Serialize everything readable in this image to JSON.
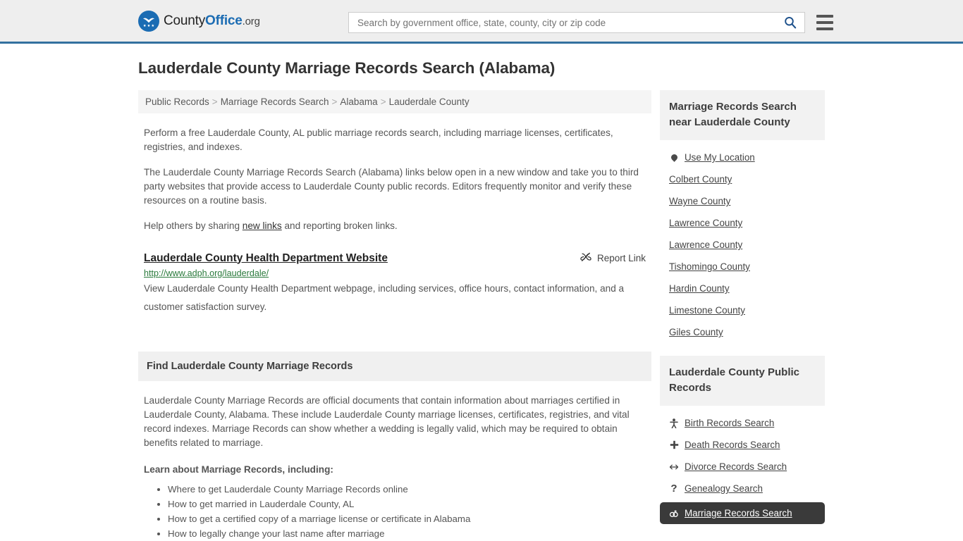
{
  "header": {
    "logo": {
      "icon": "eagle-seal-icon",
      "text_primary": "County",
      "text_bold": "Office",
      "text_suffix": ".org"
    },
    "search": {
      "placeholder": "Search by government office, state, county, city or zip code",
      "value": "",
      "search_icon": "search-icon"
    },
    "menu_icon": "hamburger-menu-icon"
  },
  "page": {
    "title": "Lauderdale County Marriage Records Search (Alabama)"
  },
  "breadcrumb": {
    "items": [
      {
        "label": "Public Records"
      },
      {
        "label": "Marriage Records Search"
      },
      {
        "label": "Alabama"
      },
      {
        "label": "Lauderdale County"
      }
    ],
    "separator": ">"
  },
  "intro": {
    "paragraph_1": "Perform a free Lauderdale County, AL public marriage records search, including marriage licenses, certificates, registries, and indexes.",
    "paragraph_2": "The Lauderdale County Marriage Records Search (Alabama) links below open in a new window and take you to third party websites that provide access to Lauderdale County public records. Editors frequently monitor and verify these resources on a routine basis.",
    "help_prefix": "Help others by sharing ",
    "help_link": "new links",
    "help_suffix": " and reporting broken links."
  },
  "result": {
    "title": "Lauderdale County Health Department Website",
    "report_label": "Report Link",
    "report_icon": "broken-link-icon",
    "url": "http://www.adph.org/lauderdale/",
    "description": "View Lauderdale County Health Department webpage, including services, office hours, contact information, and a customer satisfaction survey."
  },
  "find_section": {
    "heading": "Find Lauderdale County Marriage Records",
    "body": "Lauderdale County Marriage Records are official documents that contain information about marriages certified in Lauderdale County, Alabama. These include Lauderdale County marriage licenses, certificates, registries, and vital record indexes. Marriage Records can show whether a wedding is legally valid, which may be required to obtain benefits related to marriage.",
    "learn_label": "Learn about Marriage Records, including:",
    "learn_items": [
      "Where to get Lauderdale County Marriage Records online",
      "How to get married in Lauderdale County, AL",
      "How to get a certified copy of a marriage license or certificate in Alabama",
      "How to legally change your last name after marriage"
    ]
  },
  "sidebar": {
    "nearby": {
      "heading": "Marriage Records Search near Lauderdale County",
      "items": [
        {
          "label": "Use My Location",
          "icon": "map-pin-icon"
        },
        {
          "label": "Colbert County",
          "icon": ""
        },
        {
          "label": "Wayne County",
          "icon": ""
        },
        {
          "label": "Lawrence County",
          "icon": ""
        },
        {
          "label": "Lawrence County",
          "icon": ""
        },
        {
          "label": "Tishomingo County",
          "icon": ""
        },
        {
          "label": "Hardin County",
          "icon": ""
        },
        {
          "label": "Limestone County",
          "icon": ""
        },
        {
          "label": "Giles County",
          "icon": ""
        }
      ]
    },
    "public_records": {
      "heading": "Lauderdale County Public Records",
      "items": [
        {
          "label": "Birth Records Search",
          "icon": "baby-icon",
          "glyph": "Ɣ",
          "active": false
        },
        {
          "label": "Death Records Search",
          "icon": "cross-icon",
          "glyph": "✚",
          "active": false
        },
        {
          "label": "Divorce Records Search",
          "icon": "left-right-arrow-icon",
          "glyph": "↔",
          "active": false
        },
        {
          "label": "Genealogy Search",
          "icon": "question-mark-icon",
          "glyph": "?",
          "active": false
        },
        {
          "label": "Marriage Records Search",
          "icon": "rings-icon",
          "glyph": "⚭",
          "active": true
        }
      ]
    }
  },
  "colors": {
    "brand_blue": "#1b6cb3",
    "header_border": "#33709f",
    "header_bg": "#eeeeee",
    "panel_bg": "#f2f2f2",
    "link_green": "#2a7a3c",
    "active_bg": "#3a3a3a"
  }
}
